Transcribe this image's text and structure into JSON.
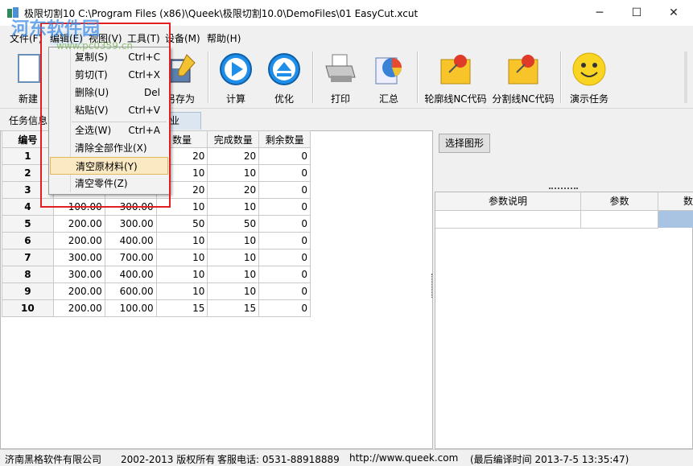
{
  "window": {
    "title": "极限切割10  C:\\Program Files (x86)\\Queek\\极限切割10.0\\DemoFiles\\01 EasyCut.xcut",
    "minimize": "─",
    "maximize": "☐",
    "close": "✕"
  },
  "menu": {
    "file": "文件(F)",
    "edit": "编辑(E)",
    "view": "视图(V)",
    "tools": "工具(T)",
    "device": "设备(M)",
    "help": "帮助(H)"
  },
  "toolbar": {
    "new": "新建",
    "save_as": "另存为",
    "calc": "计算",
    "optimize": "优化",
    "print": "打印",
    "summary": "汇总",
    "contour_nc": "轮廓线NC代码",
    "split_nc": "分割线NC代码",
    "demo": "演示任务"
  },
  "tabs": {
    "task_info": "任务信息",
    "job": "业"
  },
  "grid": {
    "headers": [
      "编号",
      "",
      "",
      "数量",
      "完成数量",
      "剩余数量"
    ],
    "rows": [
      [
        "1",
        "",
        "",
        "20",
        "20",
        "0"
      ],
      [
        "2",
        "",
        "",
        "10",
        "10",
        "0"
      ],
      [
        "3",
        "",
        "300.00",
        "20",
        "20",
        "0"
      ],
      [
        "4",
        "100.00",
        "300.00",
        "10",
        "10",
        "0"
      ],
      [
        "5",
        "200.00",
        "300.00",
        "50",
        "50",
        "0"
      ],
      [
        "6",
        "200.00",
        "400.00",
        "10",
        "10",
        "0"
      ],
      [
        "7",
        "300.00",
        "700.00",
        "10",
        "10",
        "0"
      ],
      [
        "8",
        "300.00",
        "400.00",
        "10",
        "10",
        "0"
      ],
      [
        "9",
        "200.00",
        "600.00",
        "10",
        "10",
        "0"
      ],
      [
        "10",
        "200.00",
        "100.00",
        "15",
        "15",
        "0"
      ]
    ]
  },
  "right_pane": {
    "select_shape": "选择图形",
    "col_desc": "参数说明",
    "col_param": "参数",
    "col_extra": "数"
  },
  "edit_menu": {
    "copy": {
      "label": "复制(S)",
      "shortcut": "Ctrl+C"
    },
    "cut": {
      "label": "剪切(T)",
      "shortcut": "Ctrl+X"
    },
    "delete": {
      "label": "删除(U)",
      "shortcut": "Del"
    },
    "paste": {
      "label": "粘贴(V)",
      "shortcut": "Ctrl+V"
    },
    "select_all": {
      "label": "全选(W)",
      "shortcut": "Ctrl+A"
    },
    "clear_jobs": {
      "label": "清除全部作业(X)"
    },
    "clear_material": {
      "label": "清空原材料(Y)"
    },
    "clear_parts": {
      "label": "清空零件(Z)"
    }
  },
  "statusbar": {
    "company": "济南黑格软件有限公司",
    "copyright": "2002-2013 版权所有",
    "phone": "客服电话: 0531-88918889",
    "url": "http://www.queek.com",
    "build": "(最后编译时间 2013-7-5 13:35:47)"
  },
  "watermark": {
    "text": "河东软件园",
    "site": "www.pc0359.cn"
  },
  "colors": {
    "highlight_border": "#e02020",
    "menu_hover": "#fbe9c4"
  }
}
